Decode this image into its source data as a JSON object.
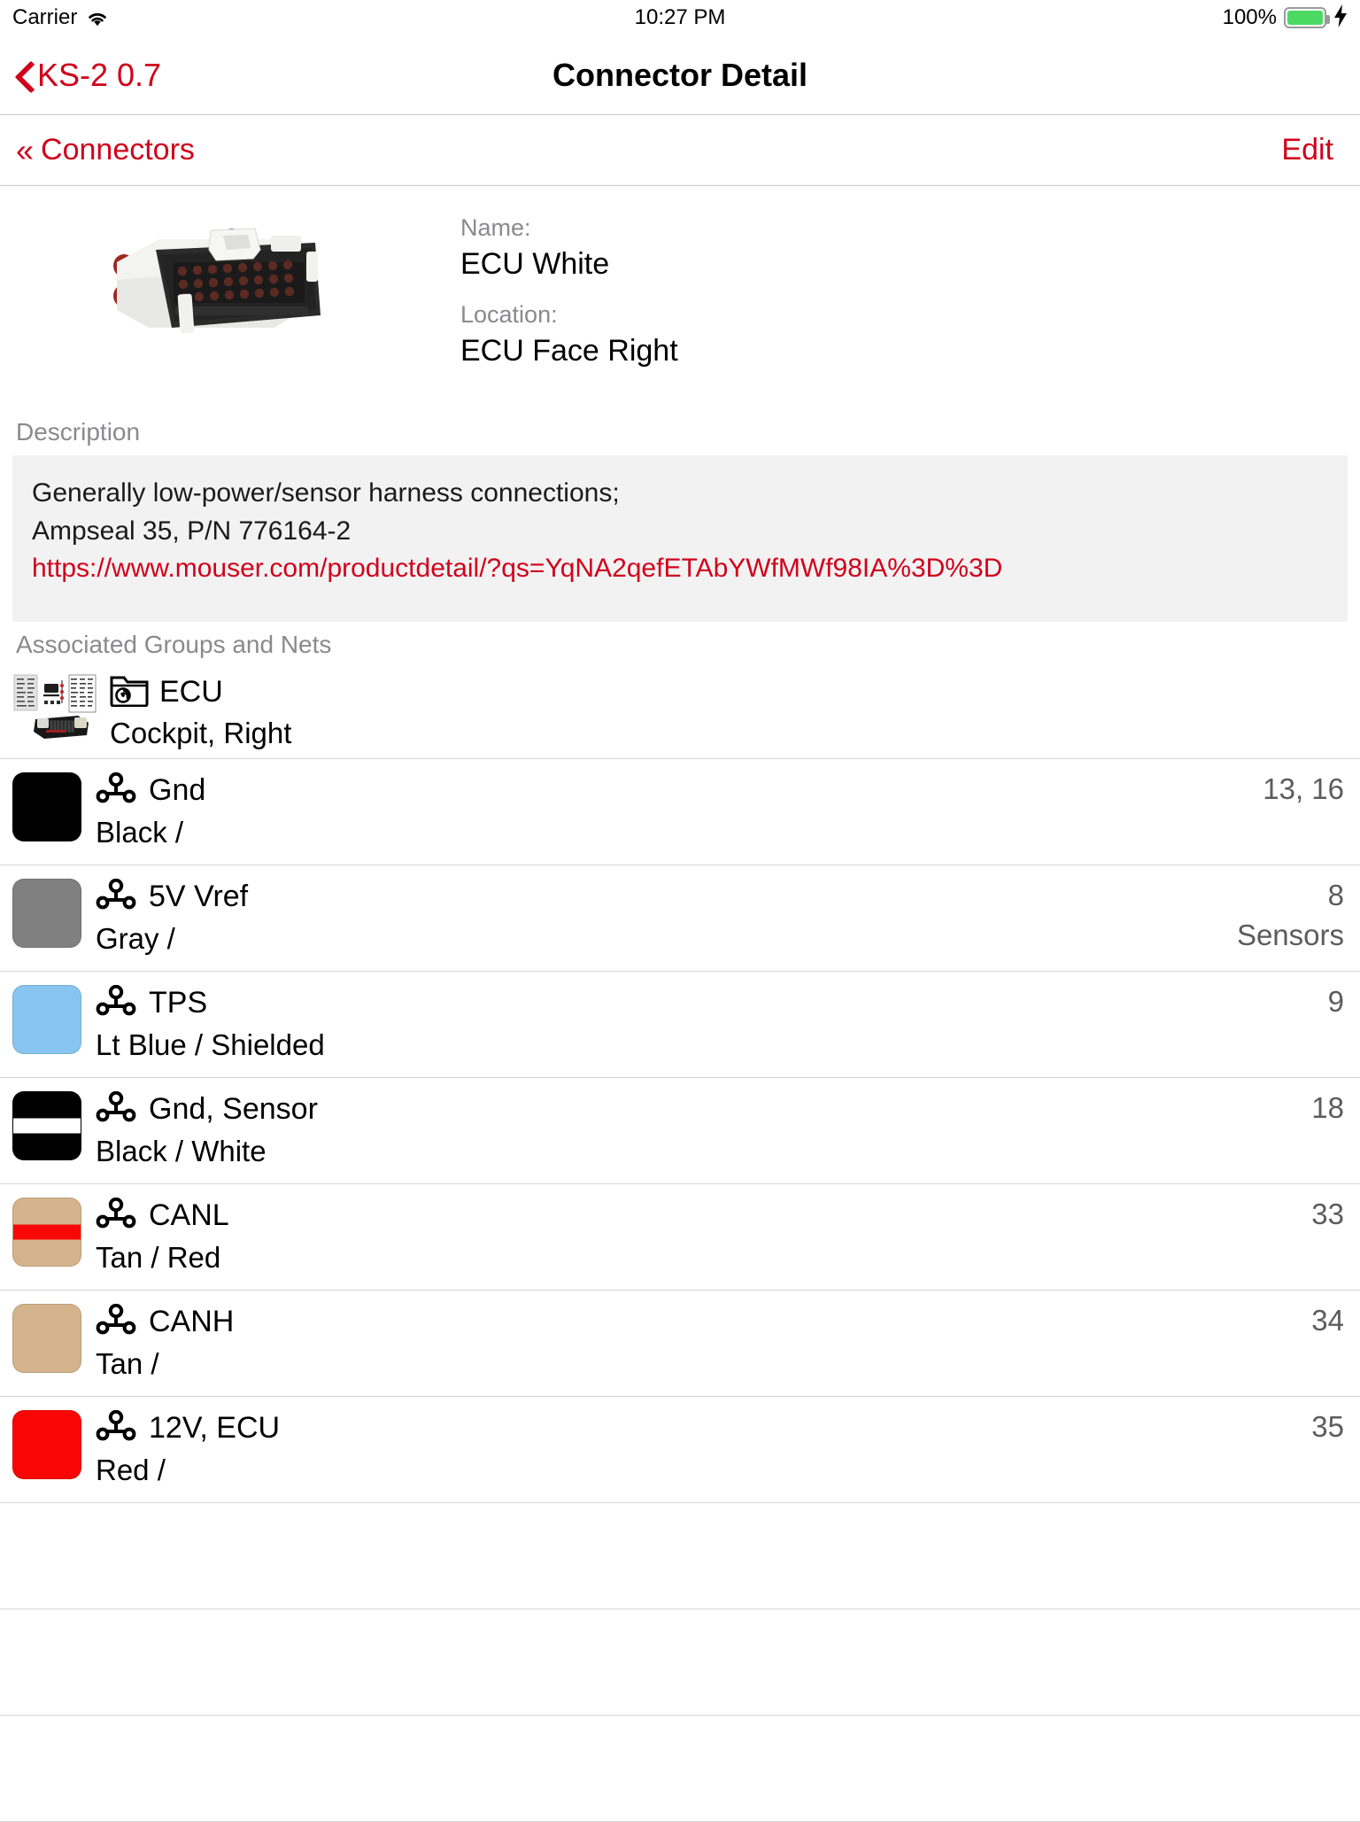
{
  "status_bar": {
    "carrier": "Carrier",
    "wifi_icon": "wifi-icon",
    "time": "10:27 PM",
    "battery_percent": "100%",
    "battery_icon": "battery-icon",
    "charging_icon": "lightning-bolt-icon"
  },
  "nav": {
    "back_icon": "chevron-left-icon",
    "back_label": "KS-2 0.7",
    "title": "Connector Detail"
  },
  "toolbar": {
    "back_chevrons_icon": "double-chevron-left-icon",
    "back_label": "Connectors",
    "edit_label": "Edit"
  },
  "connector": {
    "image_icon": "connector-photo",
    "name_label": "Name:",
    "name_value": "ECU White",
    "location_label": "Location:",
    "location_value": "ECU Face Right"
  },
  "description": {
    "section_label": "Description",
    "line1": "Generally low-power/sensor harness connections;",
    "line2": "Ampseal 35, P/N 776164-2",
    "link": "https://www.mouser.com/productdetail/?qs=YqNA2qefETAbYWfMWf98IA%3D%3D"
  },
  "associated": {
    "section_label": "Associated Groups and Nets",
    "group": {
      "thumb_icon": "group-photo",
      "folder_icon": "folder-disc-icon",
      "title": "ECU",
      "subtitle": "Cockpit, Right"
    },
    "net_icon": "net-junction-icon",
    "nets": [
      {
        "name": "Gnd",
        "colors": "Black /",
        "pins": "13, 16",
        "note": "",
        "swatch_base": "#000000",
        "swatch_stripe": ""
      },
      {
        "name": "5V Vref",
        "colors": "Gray /",
        "pins": "8",
        "note": "Sensors",
        "swatch_base": "#808080",
        "swatch_stripe": ""
      },
      {
        "name": "TPS",
        "colors": "Lt Blue / Shielded",
        "pins": "9",
        "note": "",
        "swatch_base": "#87c5f0",
        "swatch_stripe": ""
      },
      {
        "name": "Gnd, Sensor",
        "colors": "Black / White",
        "pins": "18",
        "note": "",
        "swatch_base": "#000000",
        "swatch_stripe": "#ffffff"
      },
      {
        "name": "CANL",
        "colors": "Tan / Red",
        "pins": "33",
        "note": "",
        "swatch_base": "#d4b48c",
        "swatch_stripe": "#fa0707"
      },
      {
        "name": "CANH",
        "colors": "Tan /",
        "pins": "34",
        "note": "",
        "swatch_base": "#d4b48c",
        "swatch_stripe": ""
      },
      {
        "name": "12V, ECU",
        "colors": "Red /",
        "pins": "35",
        "note": "",
        "swatch_base": "#fa0505",
        "swatch_stripe": ""
      }
    ],
    "empty_rows": 3
  },
  "colors": {
    "accent": "#d0021b",
    "separator": "#d6d6d6",
    "secondary_text": "#8a8a8e",
    "desc_background": "#f2f2f2",
    "battery_green": "#4CD964"
  }
}
